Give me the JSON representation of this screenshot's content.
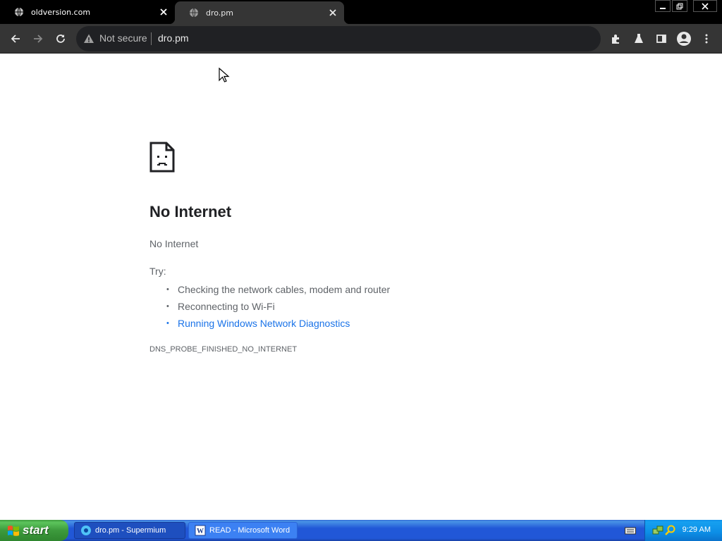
{
  "browser": {
    "tabs": [
      {
        "title": "oldversion.com",
        "active": false
      },
      {
        "title": "dro.pm",
        "active": true
      }
    ],
    "omnibox": {
      "security_label": "Not secure",
      "url": "dro.pm"
    }
  },
  "page": {
    "heading": "No Internet",
    "subheading": "No Internet",
    "try_label": "Try:",
    "suggestions": [
      "Checking the network cables, modem and router",
      "Reconnecting to Wi-Fi",
      "Running Windows Network Diagnostics"
    ],
    "error_code": "DNS_PROBE_FINISHED_NO_INTERNET"
  },
  "taskbar": {
    "start_label": "start",
    "tasks": [
      {
        "label": "dro.pm - Supermium",
        "icon": "supermium-icon"
      },
      {
        "label": "READ - Microsoft Word",
        "icon": "word-icon"
      }
    ],
    "clock": "9:29 AM"
  },
  "colors": {
    "link": "#1a73e8",
    "toolbar": "#353535",
    "taskbar": "#2157d7",
    "start": "#3c9a3c"
  }
}
